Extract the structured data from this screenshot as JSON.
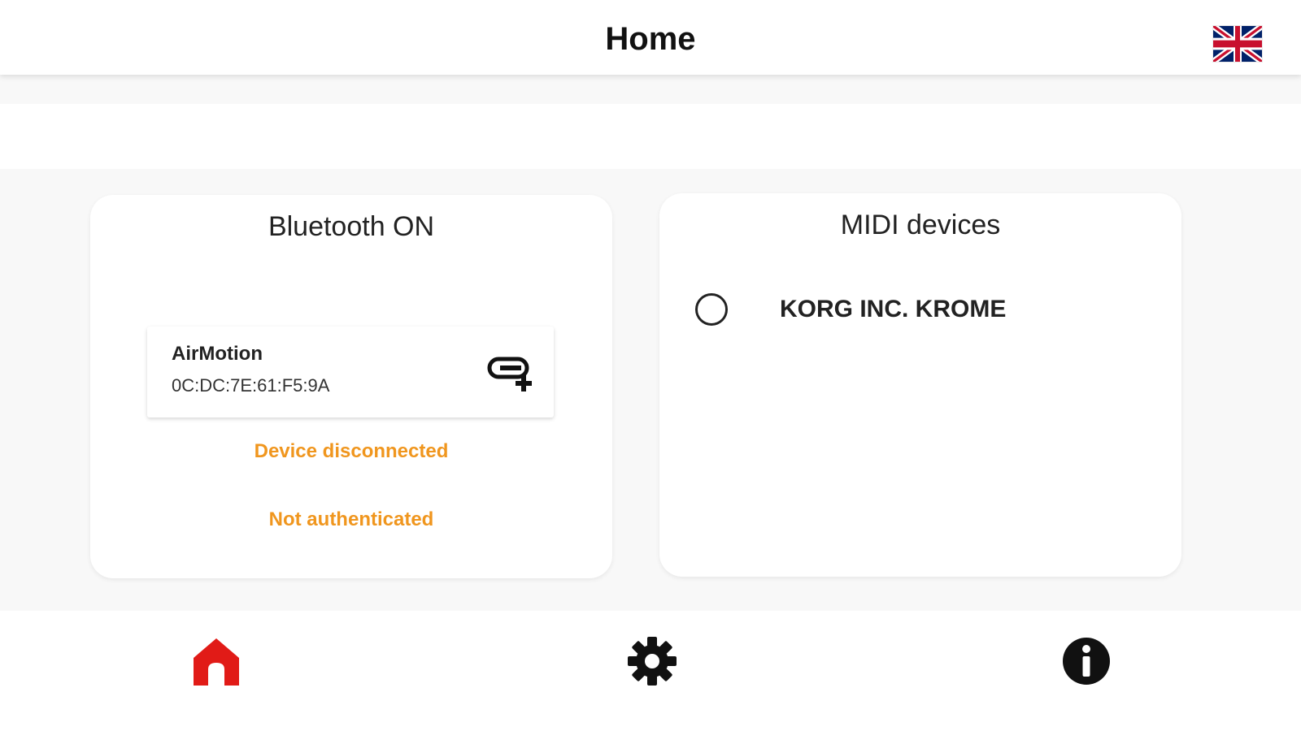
{
  "appbar": {
    "title": "Home",
    "language_icon": "uk-flag-icon"
  },
  "bluetooth_card": {
    "title": "Bluetooth ON",
    "device": {
      "name": "AirMotion",
      "mac": "0C:DC:7E:61:F5:9A",
      "action_icon": "link-add-icon"
    },
    "status_connection": "Device disconnected",
    "status_auth": "Not authenticated",
    "status_color": "#f0961e"
  },
  "midi_card": {
    "title": "MIDI devices",
    "devices": [
      {
        "label": "KORG INC. KROME",
        "selected": false
      }
    ]
  },
  "bottom_nav": {
    "items": [
      {
        "icon": "home-icon",
        "active": true,
        "color": "#e11b17"
      },
      {
        "icon": "gear-icon",
        "active": false,
        "color": "#111111"
      },
      {
        "icon": "info-icon",
        "active": false,
        "color": "#111111"
      }
    ]
  }
}
